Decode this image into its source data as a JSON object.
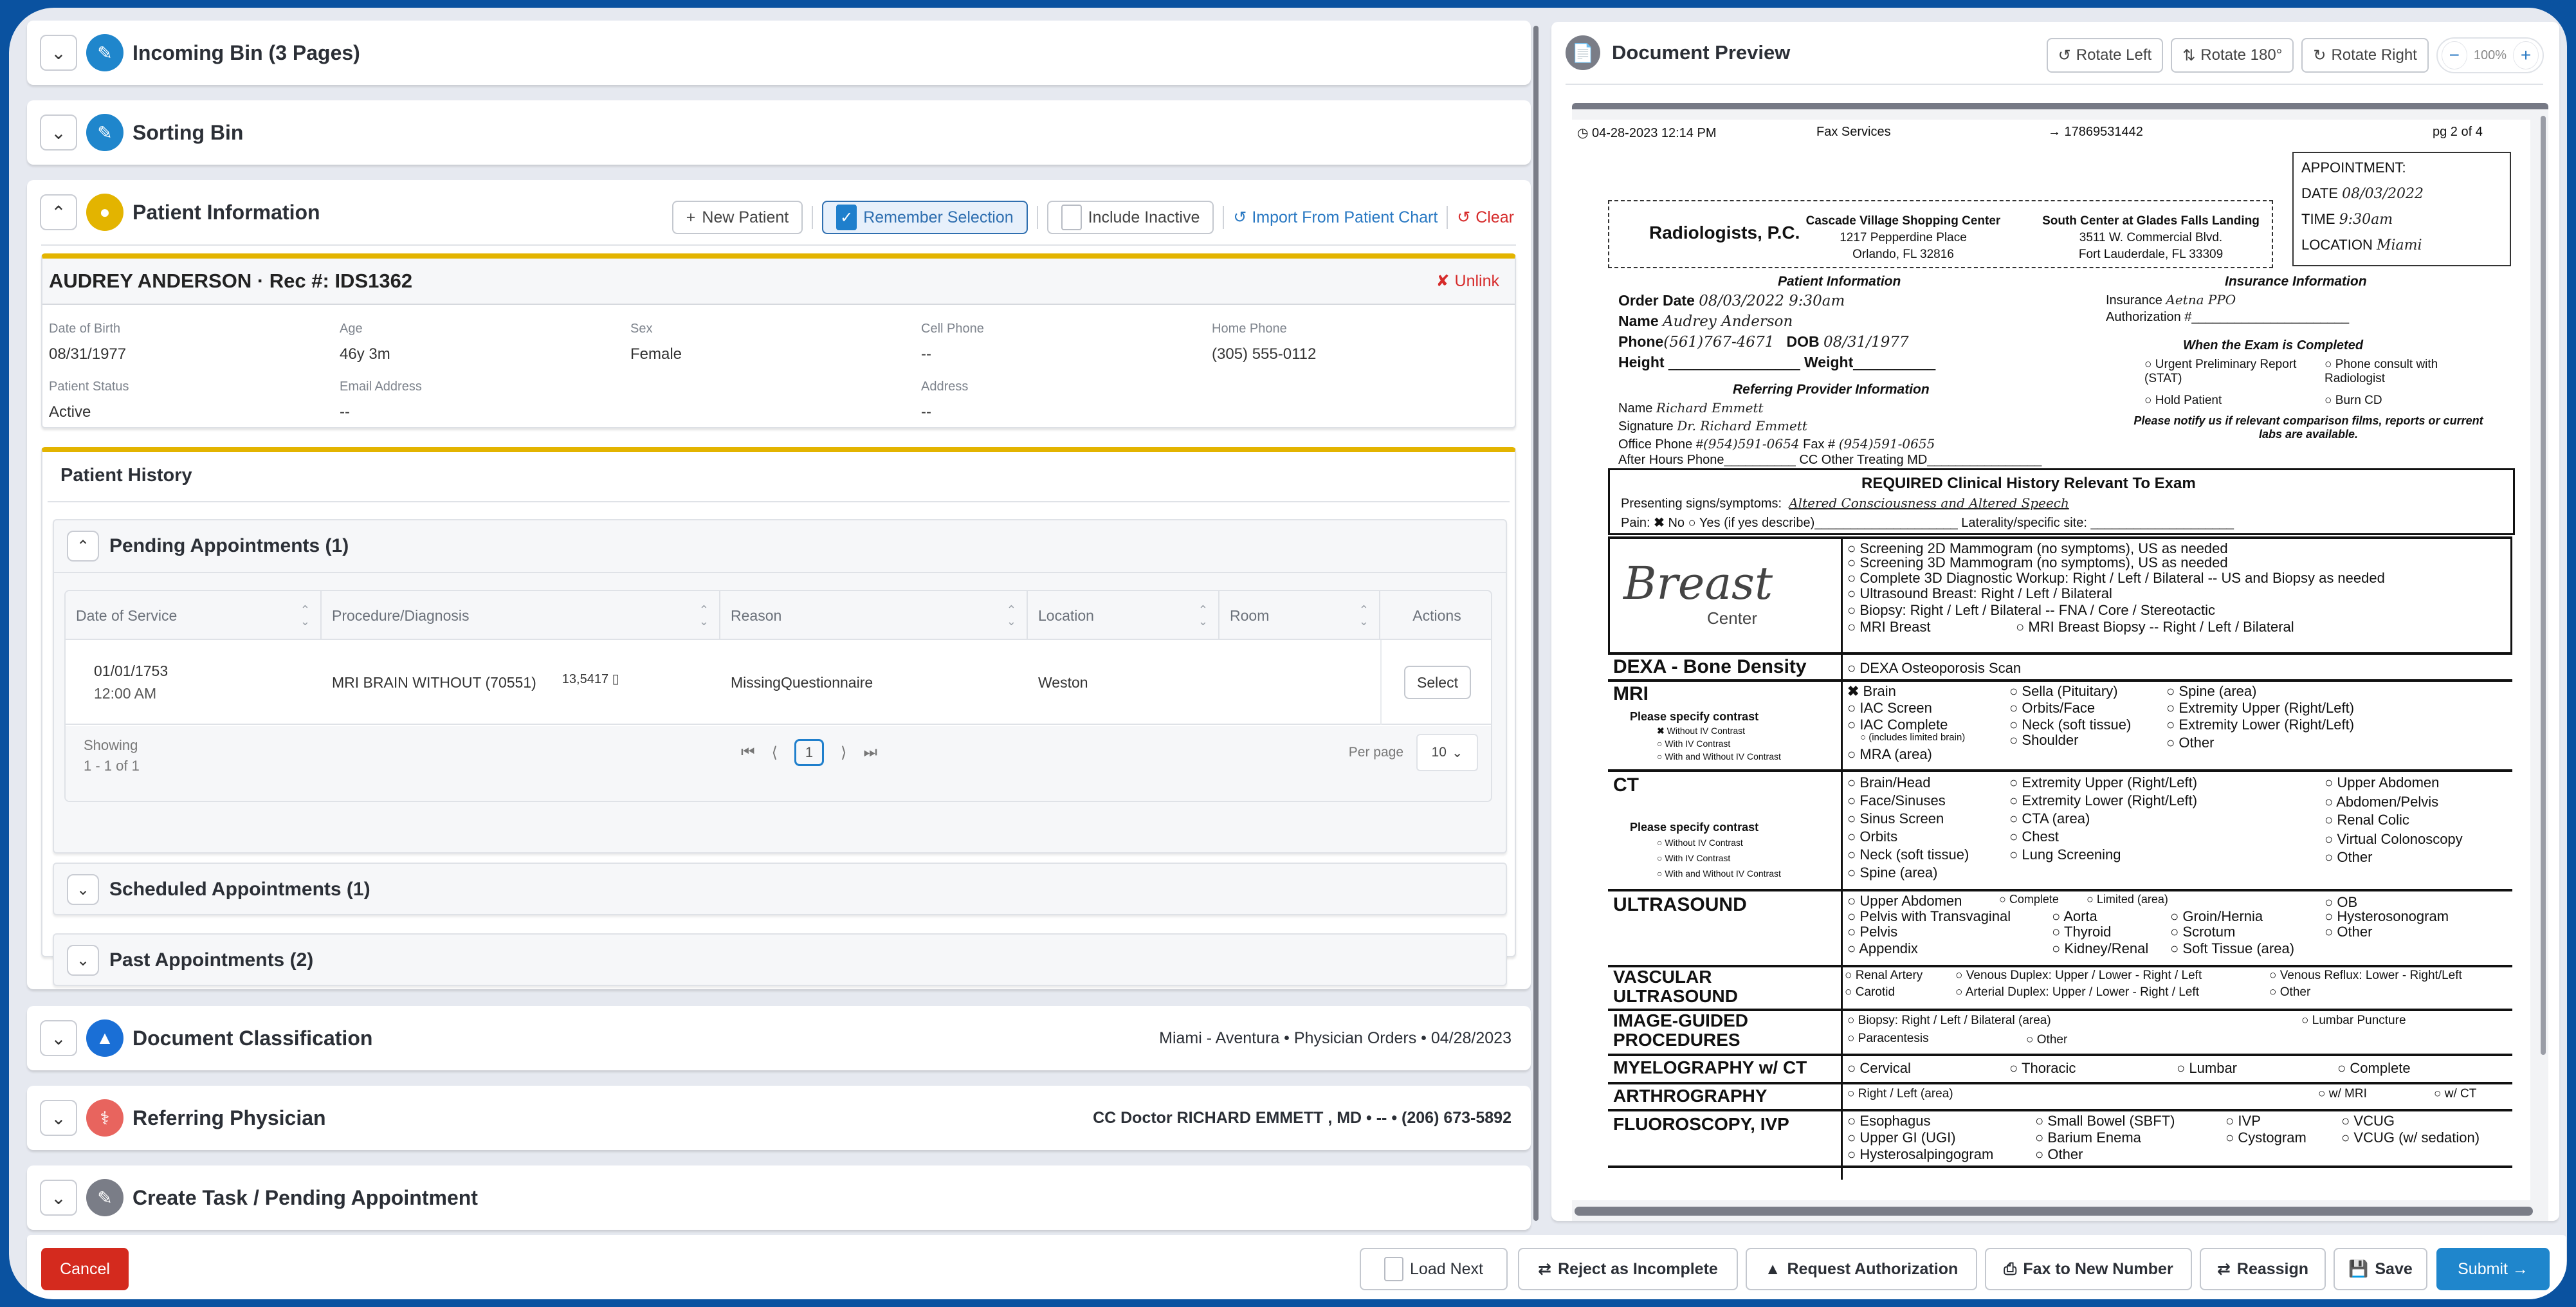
{
  "sections": {
    "incoming_bin": {
      "title": "Incoming Bin (3 Pages)",
      "icon": "document-sign-icon"
    },
    "sorting_bin": {
      "title": "Sorting Bin",
      "icon": "document-sign-icon"
    },
    "patient_information": {
      "title": "Patient Information",
      "toolbar": {
        "new_patient": "New Patient",
        "remember_selection": "Remember Selection",
        "remember_selection_checked": true,
        "include_inactive": "Include Inactive",
        "include_inactive_checked": false,
        "import_from_chart": "Import From Patient Chart",
        "clear": "Clear"
      },
      "patient": {
        "name_line": "AUDREY ANDERSON",
        "rec_line": "Rec #: IDS1362",
        "unlink": "Unlink",
        "fields": [
          {
            "label": "Date of Birth",
            "value": "08/31/1977"
          },
          {
            "label": "Age",
            "value": "46y 3m"
          },
          {
            "label": "Sex",
            "value": "Female"
          },
          {
            "label": "Cell Phone",
            "value": "--"
          },
          {
            "label": "Home Phone",
            "value": "(305) 555-0112"
          },
          {
            "label": "Patient Status",
            "value": "Active"
          },
          {
            "label": "Email Address",
            "value": "--"
          },
          {
            "label": "Address",
            "value": "--"
          }
        ]
      },
      "history": {
        "title": "Patient History",
        "pending": {
          "title": "Pending Appointments (1)",
          "columns": [
            "Date of Service",
            "Procedure/Diagnosis",
            "Reason",
            "Location",
            "Room",
            "Actions"
          ],
          "rows": [
            {
              "date": "01/01/1753",
              "time": "12:00 AM",
              "procedure": "MRI BRAIN WITHOUT (70551)",
              "code": "13,5417 ▯",
              "reason": "MissingQuestionnaire",
              "location": "Weston",
              "room": "",
              "action": "Select"
            }
          ],
          "showing_label": "Showing",
          "showing_range": "1 - 1 of 1",
          "current_page": "1",
          "per_page_label": "Per page",
          "per_page_value": "10"
        },
        "scheduled": {
          "title": "Scheduled Appointments (1)"
        },
        "past": {
          "title": "Past Appointments (2)"
        }
      }
    },
    "document_classification": {
      "title": "Document Classification",
      "meta": "Miami - Aventura  •  Physician Orders  •  04/28/2023"
    },
    "referring_physician": {
      "title": "Referring Physician",
      "meta": "CC Doctor RICHARD EMMETT , MD  •  --  •  (206) 673-5892"
    },
    "create_task": {
      "title": "Create Task / Pending Appointment"
    }
  },
  "preview": {
    "title": "Document Preview",
    "rotate_left": "Rotate Left",
    "rotate_180": "Rotate 180°",
    "rotate_right": "Rotate Right",
    "zoom_level": "100%",
    "fax": {
      "header_time": "04-28-2023 12:14 PM",
      "header_service": "Fax Services",
      "header_number": "→ 17869531442",
      "header_page": "pg 2 of 4",
      "logo": "Radiologists, P.C.",
      "loc1_name": "Cascade Village Shopping Center",
      "loc1_addr1": "1217 Pepperdine Place",
      "loc1_addr2": "Orlando, FL 32816",
      "loc2_name": "South Center at Glades Falls Landing",
      "loc2_addr1": "3511 W. Commercial Blvd.",
      "loc2_addr2": "Fort Lauderdale, FL 33309",
      "appt_title": "APPOINTMENT:",
      "appt_date_label": "DATE",
      "appt_date": "08/03/2022",
      "appt_time_label": "TIME",
      "appt_time": "9:30am",
      "appt_loc_label": "LOCATION",
      "appt_loc": "Miami",
      "patient_info_title": "Patient Information",
      "order_date_label": "Order Date",
      "order_date": "08/03/2022 9:30am",
      "name_label": "Name",
      "name": "Audrey Anderson",
      "phone_label": "Phone",
      "phone": "(561)767-4671",
      "dob_label": "DOB",
      "dob": "08/31/1977",
      "height_label": "Height",
      "weight_label": "Weight",
      "ref_title": "Referring Provider Information",
      "ref_name_label": "Name",
      "ref_name": "Richard Emmett",
      "sig_label": "Signature",
      "sig": "Dr. Richard Emmett",
      "office_phone_label": "Office Phone #",
      "office_phone": "(954)591-0654",
      "fax_label": "Fax #",
      "fax": "(954)591-0655",
      "after_hours_label": "After Hours Phone",
      "cc_label": "CC Other Treating MD",
      "ins_title": "Insurance Information",
      "ins_label": "Insurance",
      "ins": "Aetna PPO",
      "auth_label": "Authorization #",
      "exam_title": "When the Exam is Completed",
      "exam_opts": [
        "Urgent Preliminary Report (STAT)",
        "Phone consult with Radiologist",
        "Hold Patient",
        "Burn CD"
      ],
      "notify": "Please notify us if relevant comparison films, reports or current labs are available.",
      "clin_title": "REQUIRED Clinical History Relevant To Exam",
      "symptoms_label": "Presenting signs/symptoms:",
      "symptoms": "Altered Consciousness and Altered Speech",
      "pain_label": "Pain:",
      "pain_no": "No",
      "pain_yes": "Yes (if yes describe)",
      "laterality_label": "Laterality/specific site:",
      "breast_logo": "Breast",
      "breast_logo_sub": "Center",
      "breast_opts": [
        "Screening 2D Mammogram (no symptoms), US as needed",
        "Screening 3D Mammogram (no symptoms), US as needed",
        "Complete 3D Diagnostic Workup:  Right / Left / Bilateral -- US and Biopsy as needed",
        "Ultrasound Breast:  Right / Left / Bilateral",
        "Biopsy: Right / Left / Bilateral -- FNA / Core / Stereotactic",
        "MRI Breast",
        "MRI Breast Biopsy -- Right / Left / Bilateral"
      ],
      "dexa_label": "DEXA - Bone Density",
      "dexa_opt": "DEXA Osteoporosis Scan",
      "mri_label": "MRI",
      "contrast_label": "Please specify contrast",
      "contrast_opts": [
        "Without IV Contrast",
        "With IV Contrast",
        "With and Without IV Contrast"
      ],
      "mri_opts": [
        "Brain",
        "IAC Screen",
        "IAC Complete",
        "(includes limited brain)",
        "MRA (area)",
        "Sella (Pituitary)",
        "Orbits/Face",
        "Neck (soft tissue)",
        "Shoulder",
        "Spine (area)",
        "Extremity Upper (Right/Left)",
        "Extremity Lower (Right/Left)",
        "Other"
      ],
      "ct_label": "CT",
      "ct_opts": [
        "Brain/Head",
        "Face/Sinuses",
        "Sinus Screen",
        "Orbits",
        "Neck (soft tissue)",
        "Spine (area)",
        "Extremity Upper (Right/Left)",
        "Extremity Lower (Right/Left)",
        "CTA (area)",
        "Chest",
        "Lung Screening",
        "Upper Abdomen",
        "Abdomen/Pelvis",
        "Renal Colic",
        "Virtual Colonoscopy",
        "Other"
      ],
      "us_label": "ULTRASOUND",
      "us_opts": [
        "Upper Abdomen",
        "Complete",
        "Limited (area)",
        "OB",
        "Pelvis with Transvaginal",
        "Aorta",
        "Groin/Hernia",
        "Hysterosonogram",
        "Pelvis",
        "Thyroid",
        "Scrotum",
        "Other",
        "Appendix",
        "Kidney/Renal",
        "Soft Tissue (area)"
      ],
      "vasc_label_1": "VASCULAR",
      "vasc_label_2": "ULTRASOUND",
      "vasc_opts": [
        "Renal Artery",
        "Venous Duplex: Upper / Lower - Right / Left",
        "Venous Reflux: Lower - Right/Left",
        "Carotid",
        "Arterial Duplex: Upper / Lower - Right / Left",
        "Other"
      ],
      "ig_label_1": "IMAGE-GUIDED",
      "ig_label_2": "PROCEDURES",
      "ig_opts": [
        "Biopsy: Right / Left / Bilateral (area)",
        "Lumbar Puncture",
        "Paracentesis",
        "Other"
      ],
      "myelo_label": "MYELOGRAPHY w/ CT",
      "myelo_opts": [
        "Cervical",
        "Thoracic",
        "Lumbar",
        "Complete"
      ],
      "arthro_label": "ARTHROGRAPHY",
      "arthro_opts": [
        "Right / Left (area)",
        "w/ MRI",
        "w/ CT"
      ],
      "fluoro_label": "FLUOROSCOPY, IVP",
      "fluoro_opts": [
        "Esophagus",
        "Small Bowel (SBFT)",
        "IVP",
        "VCUG",
        "Upper GI (UGI)",
        "Barium Enema",
        "Cystogram",
        "VCUG (w/ sedation)",
        "Hysterosalpingogram",
        "Other"
      ]
    }
  },
  "footer": {
    "cancel": "Cancel",
    "load_next": "Load Next",
    "reject": "Reject as Incomplete",
    "request_auth": "Request Authorization",
    "fax_new": "Fax to New Number",
    "reassign": "Reassign",
    "save": "Save",
    "submit": "Submit →"
  },
  "colors": {
    "brand_blue": "#0a52a0",
    "accent_yellow": "#e3b400",
    "cancel_red": "#d42a1e",
    "submit_blue": "#1f86cc"
  }
}
